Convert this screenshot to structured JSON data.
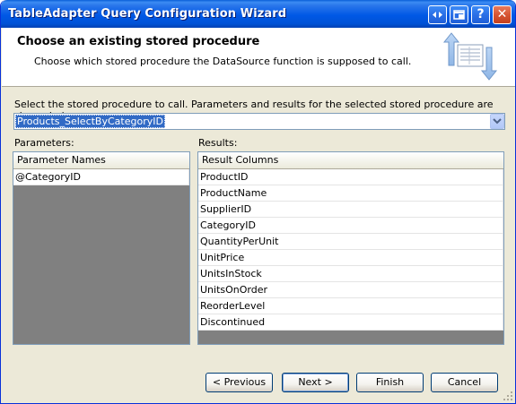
{
  "window": {
    "title": "TableAdapter Query Configuration Wizard",
    "buttons": {
      "help": "?",
      "close": "✕"
    }
  },
  "header": {
    "title": "Choose an existing stored procedure",
    "subtitle": "Choose which stored procedure the DataSource function is supposed to call."
  },
  "prompt": "Select the stored procedure to call. Parameters and results for the selected stored procedure are shown below.",
  "stored_procedure_select": {
    "value": "Products_SelectByCategoryID"
  },
  "parameters": {
    "label": "Parameters:",
    "column_header": "Parameter Names",
    "rows": [
      "@CategoryID"
    ]
  },
  "results": {
    "label": "Results:",
    "column_header": "Result Columns",
    "rows": [
      "ProductID",
      "ProductName",
      "SupplierID",
      "CategoryID",
      "QuantityPerUnit",
      "UnitPrice",
      "UnitsInStock",
      "UnitsOnOrder",
      "ReorderLevel",
      "Discontinued"
    ]
  },
  "footer_buttons": {
    "previous": "< Previous",
    "next": "Next >",
    "finish": "Finish",
    "cancel": "Cancel"
  },
  "colors": {
    "titlebar": "#0058e6",
    "selection": "#316ac5",
    "grid_empty": "#808080",
    "dialog_bg": "#ece9d8"
  }
}
